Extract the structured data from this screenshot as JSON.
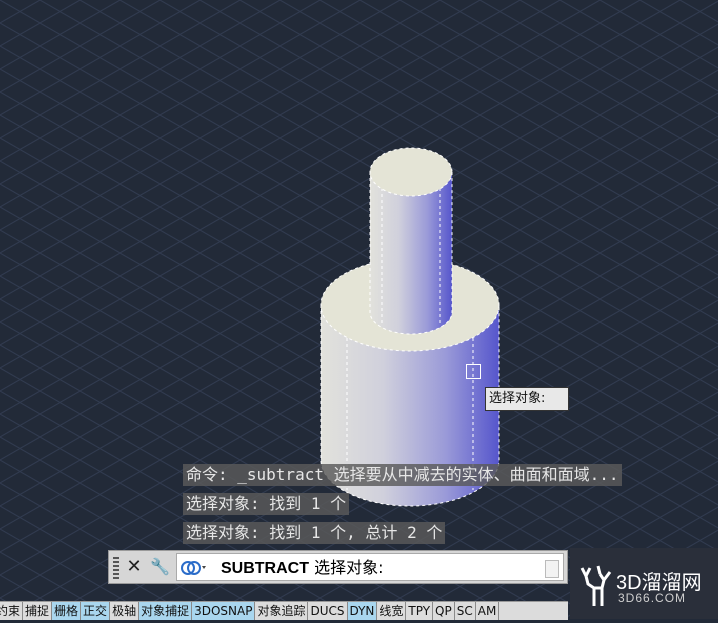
{
  "command_history": [
    "命令: _subtract 选择要从中减去的实体、曲面和面域...",
    "选择对象: 找到 1 个",
    "选择对象: 找到 1 个, 总计 2 个"
  ],
  "tooltip": "选择对象:",
  "command_line": {
    "close_icon": "✕",
    "customize_icon": "🔧",
    "command": "SUBTRACT",
    "prompt": "选择对象:"
  },
  "status_bar": {
    "buttons": [
      {
        "label": "推断约束",
        "on": false
      },
      {
        "label": "捕捉",
        "on": false
      },
      {
        "label": "栅格",
        "on": true
      },
      {
        "label": "正交",
        "on": true
      },
      {
        "label": "极轴",
        "on": false
      },
      {
        "label": "对象捕捉",
        "on": true
      },
      {
        "label": "3DOSNAP",
        "on": true
      },
      {
        "label": "对象追踪",
        "on": false
      },
      {
        "label": "DUCS",
        "on": false
      },
      {
        "label": "DYN",
        "on": true
      },
      {
        "label": "线宽",
        "on": false
      },
      {
        "label": "TPY",
        "on": false
      },
      {
        "label": "QP",
        "on": false
      },
      {
        "label": "SC",
        "on": false
      },
      {
        "label": "AM",
        "on": false
      }
    ]
  },
  "watermark": {
    "main": "3D溜溜网",
    "sub": "3D66.COM"
  },
  "colors": {
    "background": "#222a38",
    "grid": "#34405a",
    "top_face": "#e4e4d6",
    "side_dark": "#5a5ad0"
  }
}
